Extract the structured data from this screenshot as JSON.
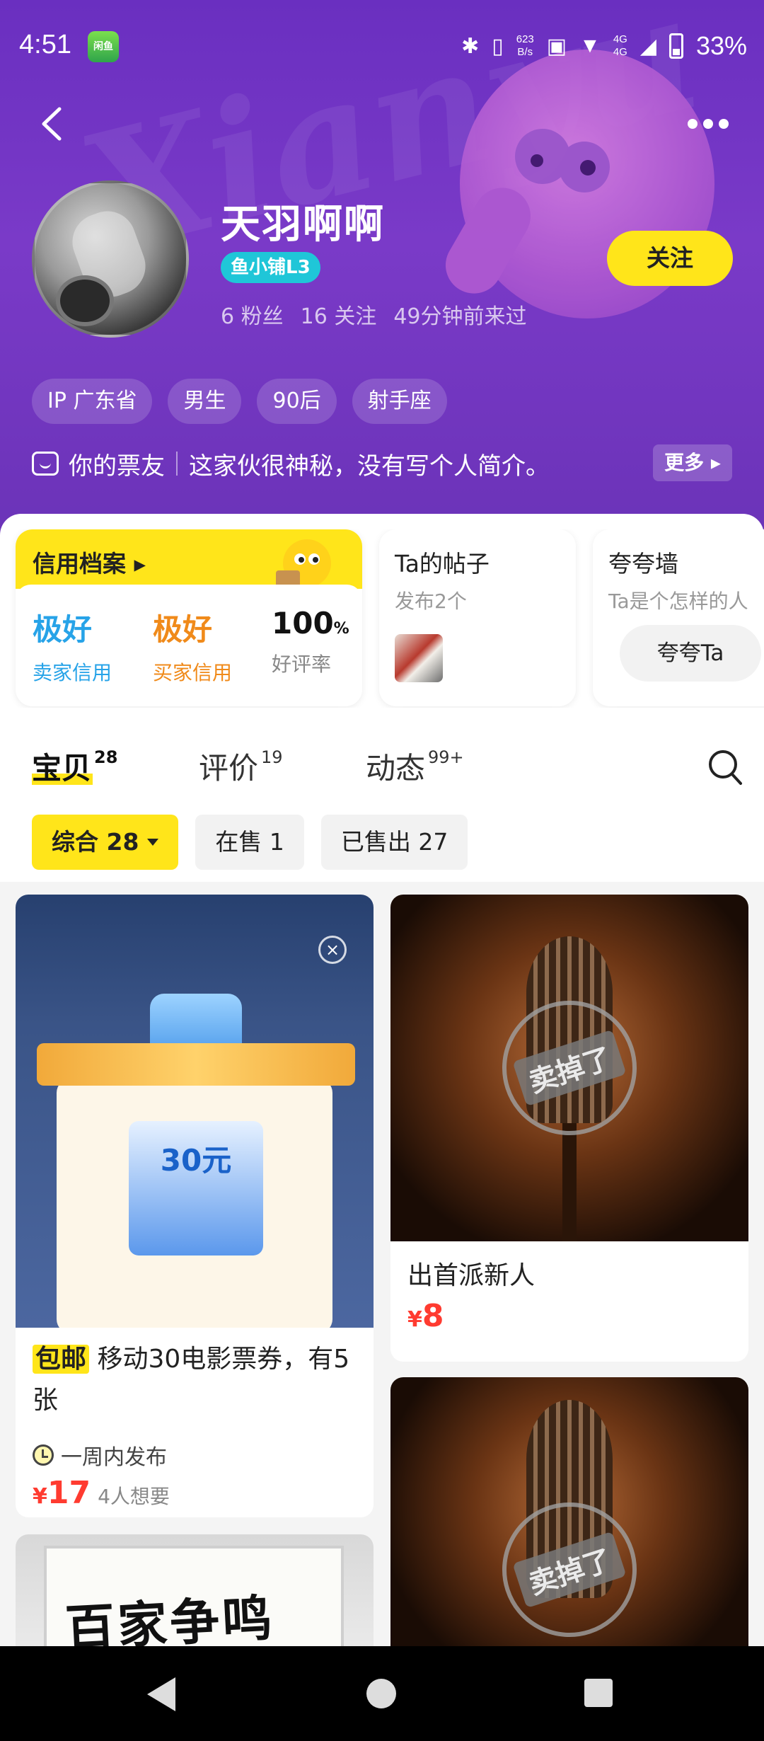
{
  "status_bar": {
    "time": "4:51",
    "app_badge": "闲鱼",
    "net_speed_value": "623",
    "net_speed_unit": "B/s",
    "signal": "4G",
    "battery": "33%"
  },
  "profile": {
    "watermark": "Xianyu",
    "username": "天羽啊啊",
    "shop_badge": "鱼小铺L3",
    "fans": "6 粉丝",
    "following": "16 关注",
    "last_seen": "49分钟前来过",
    "follow_label": "关注",
    "tags": [
      "IP 广东省",
      "男生",
      "90后",
      "射手座"
    ],
    "bio_prefix": "你的票友",
    "bio_text": "这家伙很神秘，没有写个人简介。",
    "bio_more": "更多"
  },
  "credit": {
    "title": "信用档案",
    "seller_value": "极好",
    "seller_label": "卖家信用",
    "buyer_value": "极好",
    "buyer_label": "买家信用",
    "rating_value": "100",
    "rating_unit": "%",
    "rating_label": "好评率"
  },
  "posts_card": {
    "title": "Ta的帖子",
    "subtitle": "发布2个"
  },
  "praise_card": {
    "title": "夸夸墙",
    "subtitle": "Ta是个怎样的人",
    "button": "夸夸Ta"
  },
  "tabs": [
    {
      "label": "宝贝",
      "count": "28"
    },
    {
      "label": "评价",
      "count": "19"
    },
    {
      "label": "动态",
      "count": "99+"
    }
  ],
  "filters": [
    "综合 28",
    "在售 1",
    "已售出 27"
  ],
  "items": [
    {
      "free_shipping": "包邮",
      "title": "移动30电影票券，有5张",
      "time_tag": "一周内发布",
      "currency": "¥",
      "price": "17",
      "wants": "4人想要",
      "coupon_amount": "30元"
    },
    {
      "title": "出首派新人",
      "currency": "¥",
      "price": "8",
      "stamp": "卖掉了"
    },
    {
      "stamp": "卖掉了"
    },
    {
      "calligraphy": "百家争鸣"
    }
  ],
  "colors": {
    "brand_yellow": "#ffe51a",
    "header_purple": "#6a2fc0",
    "price_red": "#ff3b30",
    "credit_blue": "#27a3e8",
    "credit_orange": "#f08a1a"
  }
}
